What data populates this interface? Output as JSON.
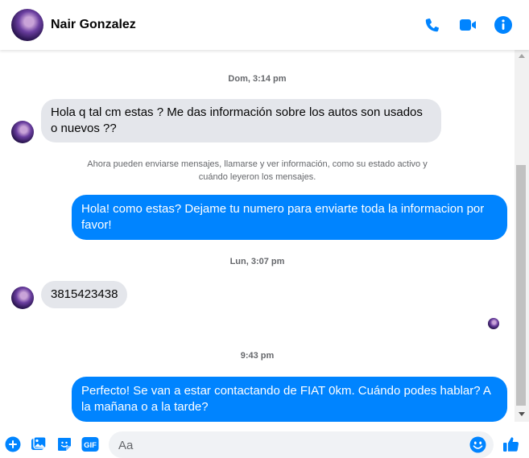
{
  "header": {
    "contact_name": "Nair Gonzalez",
    "icons": [
      "phone-icon",
      "video-call-icon",
      "info-icon"
    ]
  },
  "conversation": {
    "timestamp_1": "Dom, 3:14 pm",
    "incoming_1": "Hola q tal cm estas ? Me das información sobre los autos son usados o nuevos ??",
    "notice": "Ahora pueden enviarse mensajes, llamarse y ver información, como su estado activo y cuándo leyeron los mensajes.",
    "outgoing_1": "Hola! como estas? Dejame tu numero para enviarte toda la informacion por favor!",
    "timestamp_2": "Lun, 3:07 pm",
    "incoming_2": "3815423438",
    "timestamp_3": "9:43 pm",
    "outgoing_2": "Perfecto!  Se van a estar contactando de FIAT 0km. Cuándo podes hablar? A la mañana o a la tarde?"
  },
  "composer": {
    "placeholder": "Aa",
    "gif_label": "GIF",
    "icons": [
      "add-icon",
      "photo-icon",
      "sticker-icon",
      "gif-icon",
      "emoji-icon",
      "like-icon"
    ]
  },
  "colors": {
    "accent": "#0084ff",
    "incoming_bubble": "#e4e6eb",
    "meta_text": "#65676b"
  }
}
